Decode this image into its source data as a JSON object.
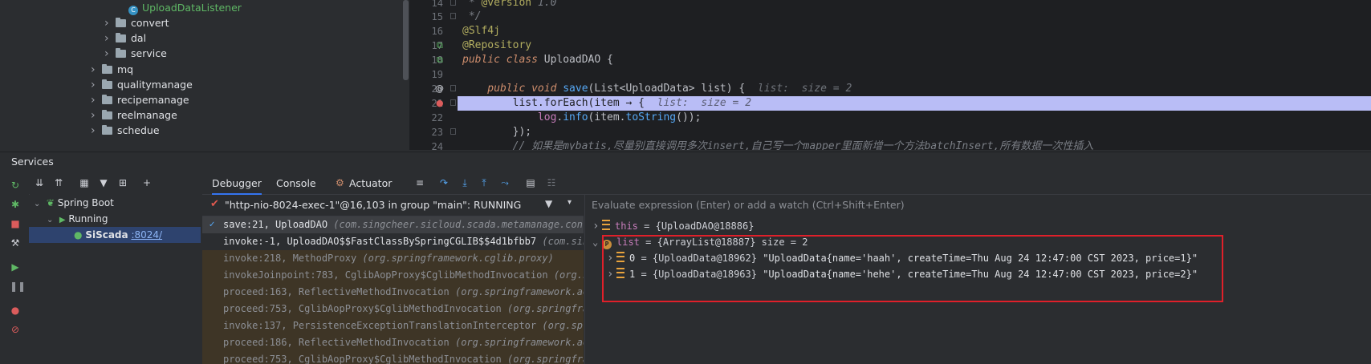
{
  "project_tree": {
    "items": [
      {
        "label": "UploadDataListener",
        "type": "class",
        "expanded": null
      },
      {
        "label": "convert",
        "type": "folder",
        "expanded": false
      },
      {
        "label": "dal",
        "type": "folder",
        "expanded": false
      },
      {
        "label": "service",
        "type": "folder",
        "expanded": false
      },
      {
        "label": "mq",
        "type": "folder",
        "expanded": false
      },
      {
        "label": "qualitymanage",
        "type": "folder",
        "expanded": false
      },
      {
        "label": "recipemanage",
        "type": "folder",
        "expanded": false
      },
      {
        "label": "reelmanage",
        "type": "folder",
        "expanded": false
      },
      {
        "label": "schedue",
        "type": "folder",
        "expanded": false
      }
    ]
  },
  "editor": {
    "lines": [
      {
        "num": "14",
        "tokens": [
          {
            "t": " * ",
            "c": "cmt"
          },
          {
            "t": "@version",
            "c": "ann"
          },
          {
            "t": " 1.0",
            "c": "cmt"
          }
        ]
      },
      {
        "num": "15",
        "tokens": [
          {
            "t": " */",
            "c": "cmt"
          }
        ]
      },
      {
        "num": "16",
        "tokens": [
          {
            "t": "@Slf4j",
            "c": "ann"
          }
        ]
      },
      {
        "num": "17",
        "tokens": [
          {
            "t": "@Repository",
            "c": "ann"
          }
        ]
      },
      {
        "num": "18",
        "tokens": [
          {
            "t": "public class ",
            "c": "kw"
          },
          {
            "t": "UploadDAO {",
            "c": ""
          }
        ]
      },
      {
        "num": "19",
        "tokens": []
      },
      {
        "num": "20",
        "tokens": [
          {
            "t": "    public void ",
            "c": "kw"
          },
          {
            "t": "save",
            "c": "fn"
          },
          {
            "t": "(List<UploadData> list) {  ",
            "c": ""
          },
          {
            "t": "list:  size = 2",
            "c": "hint"
          }
        ]
      },
      {
        "num": "21",
        "tokens": [
          {
            "t": "        list.forEach(item ",
            "c": "bp"
          },
          {
            "t": "→",
            "c": "bp"
          },
          {
            "t": " {  ",
            "c": "bp"
          },
          {
            "t": "list:  size = 2",
            "c": "hint"
          }
        ]
      },
      {
        "num": "22",
        "tokens": [
          {
            "t": "            ",
            "c": ""
          },
          {
            "t": "log",
            "c": "fld"
          },
          {
            "t": ".",
            "c": ""
          },
          {
            "t": "info",
            "c": "fn"
          },
          {
            "t": "(item.",
            "c": ""
          },
          {
            "t": "toString",
            "c": "fn"
          },
          {
            "t": "());",
            "c": ""
          }
        ]
      },
      {
        "num": "23",
        "tokens": [
          {
            "t": "        });",
            "c": ""
          }
        ]
      },
      {
        "num": "24",
        "tokens": [
          {
            "t": "        // 如果是mybatis,尽量别直接调用多次insert,自己写一个mapper里面新增一个方法batchInsert,所有数据一次性插入",
            "c": "cmt"
          }
        ]
      }
    ]
  },
  "services": {
    "title": "Services",
    "tree": [
      {
        "label": "Spring Boot",
        "level": 0
      },
      {
        "label": "Running",
        "level": 1
      },
      {
        "label": "SiScada",
        "port": ":8024/",
        "level": 2
      }
    ]
  },
  "debugger": {
    "tabs": [
      "Debugger",
      "Console",
      "Actuator"
    ],
    "thread": "\"http-nio-8024-exec-1\"@16,103 in group \"main\": RUNNING",
    "frames": [
      {
        "method": "save:21, UploadDAO",
        "pkg": "(com.singcheer.sicloud.scada.metamanage.contr",
        "kind": "active"
      },
      {
        "method": "invoke:-1, UploadDAO$$FastClassBySpringCGLIB$$4d1bfbb7",
        "pkg": "(com.sing",
        "kind": "normal"
      },
      {
        "method": "invoke:218, MethodProxy",
        "pkg": "(org.springframework.cglib.proxy)",
        "kind": "lib"
      },
      {
        "method": "invokeJoinpoint:783, CglibAopProxy$CglibMethodInvocation",
        "pkg": "(org.spri",
        "kind": "lib"
      },
      {
        "method": "proceed:163, ReflectiveMethodInvocation",
        "pkg": "(org.springframework.aop",
        "kind": "lib"
      },
      {
        "method": "proceed:753, CglibAopProxy$CglibMethodInvocation",
        "pkg": "(org.springframe",
        "kind": "lib"
      },
      {
        "method": "invoke:137, PersistenceExceptionTranslationInterceptor",
        "pkg": "(org.spri",
        "kind": "lib"
      },
      {
        "method": "proceed:186, ReflectiveMethodInvocation",
        "pkg": "(org.springframework.aop",
        "kind": "lib"
      },
      {
        "method": "proceed:753, CglibAopProxy$CglibMethodInvocation",
        "pkg": "(org.springframe",
        "kind": "lib"
      }
    ],
    "eval_placeholder": "Evaluate expression (Enter) or add a watch (Ctrl+Shift+Enter)",
    "variables": [
      {
        "name": "this",
        "value": "{UploadDAO@18886}",
        "extra": "",
        "level": 0,
        "expanded": false,
        "icon": "lines"
      },
      {
        "name": "list",
        "value": "{ArrayList@18887}",
        "extra": " size = 2",
        "level": 0,
        "expanded": true,
        "icon": "p"
      },
      {
        "name": "0",
        "value": "{UploadData@18962}",
        "extra": "\"UploadData{name='haah', createTime=Thu Aug 24 12:47:00 CST 2023, price=1}\"",
        "level": 1,
        "expanded": false,
        "icon": "lines"
      },
      {
        "name": "1",
        "value": "{UploadData@18963}",
        "extra": "\"UploadData{name='hehe', createTime=Thu Aug 24 12:47:00 CST 2023, price=2}\"",
        "level": 1,
        "expanded": false,
        "icon": "lines"
      }
    ]
  },
  "colors": {
    "highlight_box": "#e0202a",
    "breakpoint_line": "#b9bdf6",
    "selection": "#2e436e"
  }
}
